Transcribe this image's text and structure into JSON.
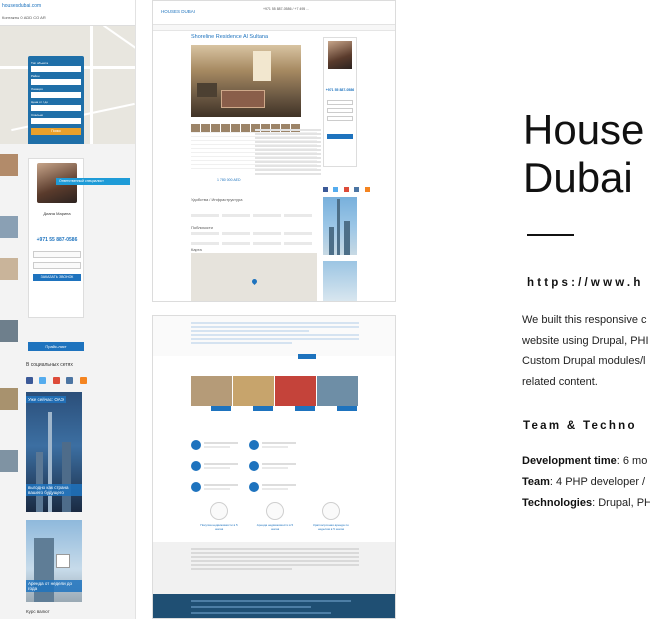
{
  "left_shot": {
    "brand": "housesdubai.com",
    "nav": "Контакты  0 ADD CO  AR",
    "filter_labels": [
      "Тип объекта",
      "Район",
      "Локация",
      "Цена от / до",
      "Спальни"
    ],
    "filter_button": "Поиск",
    "agent_name": "Диана Марина",
    "agent_phone": "+971 55 887-0586",
    "tooltip": "Ответственный специалист",
    "call_button": "ЗАКАЗАТЬ ЗВОНОК",
    "wide_button": "Прайс-лист",
    "social_title": "В социальных сетях",
    "banner1": "Уже сейчас: ОАЭ",
    "banner2": "выгодно как страна вашего будущего",
    "banner3": "Аренда от недели до года",
    "kurs": "Курс валют"
  },
  "middle_shot_1": {
    "logo": "HOUSES DUBAI",
    "phones": "+971 55 887-0586 / +7 495 ...",
    "title": "Shoreline Residence Al Sultana",
    "price": "1 780 000 AED",
    "sec_features": "Удобства / Инфраструктура",
    "sec_nearby": "Поблизости",
    "sec_map": "Карта"
  },
  "middle_shot_2": {
    "circle_labels": [
      "Покупка недвижимости в 5 шагов",
      "Аренда недвижимости в 5 шагов",
      "Краткосрочная аренда по неделям в 5 шагов"
    ]
  },
  "content": {
    "title_line1": "House",
    "title_line2": "Dubai",
    "url": "https://www.h",
    "desc_lines": [
      "We built this responsive c",
      "website using Drupal, PHI",
      "Custom Drupal modules/l",
      "related content."
    ],
    "team_heading": "Team & Techno",
    "info": [
      {
        "label": "Development time",
        "value": ": 6 mo"
      },
      {
        "label": "Team",
        "value": ": 4 PHP developer /"
      },
      {
        "label": "Technologies",
        "value": ": Drupal, PH"
      }
    ]
  }
}
